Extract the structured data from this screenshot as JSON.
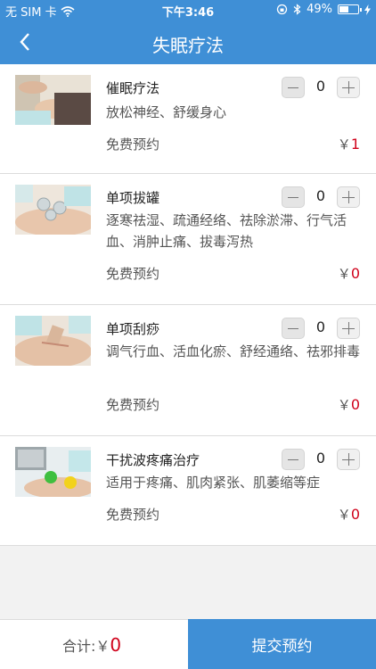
{
  "status_bar": {
    "carrier": "无 SIM 卡",
    "time": "下午3:46",
    "battery_percent": "49%",
    "battery_level": 0.49
  },
  "nav": {
    "back_icon": "chevron-left-icon",
    "title": "失眠疗法"
  },
  "items": [
    {
      "name": "催眠疗法",
      "desc": "放松神经、舒缓身心",
      "note": "免费预约",
      "currency": "￥",
      "price": "1",
      "qty": "0"
    },
    {
      "name": "单项拔罐",
      "desc": "逐寒祛湿、疏通经络、祛除淤滞、行气活血、消肿止痛、拔毒泻热",
      "note": "免费预约",
      "currency": "￥",
      "price": "0",
      "qty": "0"
    },
    {
      "name": "单项刮痧",
      "desc": "调气行血、活血化瘀、舒经通络、祛邪排毒",
      "note": "免费预约",
      "currency": "￥",
      "price": "0",
      "qty": "0"
    },
    {
      "name": "干扰波疼痛治疗",
      "desc": "适用于疼痛、肌肉紧张、肌萎缩等症",
      "note": "免费预约",
      "currency": "￥",
      "price": "0",
      "qty": "0"
    }
  ],
  "footer": {
    "total_label": "合计:",
    "currency": "￥",
    "total_amount": "0",
    "submit_label": "提交预约"
  },
  "colors": {
    "brand": "#3f8fd6",
    "price": "#d0021b"
  }
}
